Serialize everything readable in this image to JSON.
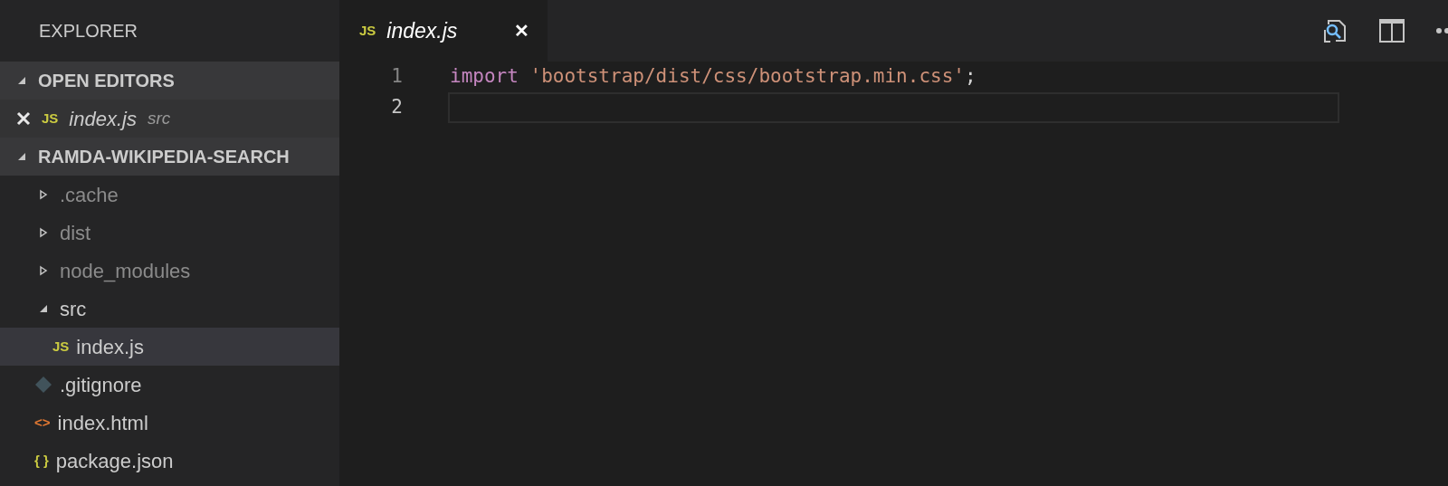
{
  "sidebar": {
    "title": "EXPLORER",
    "open_editors": {
      "title": "OPEN EDITORS",
      "expanded": true,
      "items": [
        {
          "badge": "JS",
          "name": "index.js",
          "folder": "src"
        }
      ]
    },
    "project": {
      "title": "RAMDA-WIKIPEDIA-SEARCH",
      "expanded": true,
      "items": [
        {
          "kind": "folder",
          "name": ".cache",
          "expanded": false,
          "selected": false
        },
        {
          "kind": "folder",
          "name": "dist",
          "expanded": false,
          "selected": false
        },
        {
          "kind": "folder",
          "name": "node_modules",
          "expanded": false,
          "selected": false
        },
        {
          "kind": "folder",
          "name": "src",
          "expanded": true,
          "selected": false,
          "children": [
            {
              "kind": "js",
              "badge": "JS",
              "name": "index.js",
              "selected": true
            }
          ]
        },
        {
          "kind": "git",
          "name": ".gitignore",
          "selected": false
        },
        {
          "kind": "html",
          "badge": "<>",
          "name": "index.html",
          "selected": false
        },
        {
          "kind": "json",
          "badge": "{ }",
          "name": "package.json",
          "selected": false
        }
      ]
    }
  },
  "tabs": [
    {
      "badge": "JS",
      "label": "index.js",
      "close": "✕",
      "selected": true
    }
  ],
  "editor": {
    "lines": [
      {
        "number": "1",
        "keyword": "import",
        "string": "'bootstrap/dist/css/bootstrap.min.css'",
        "punct": ";",
        "current": false
      },
      {
        "number": "2",
        "current": true
      }
    ]
  }
}
